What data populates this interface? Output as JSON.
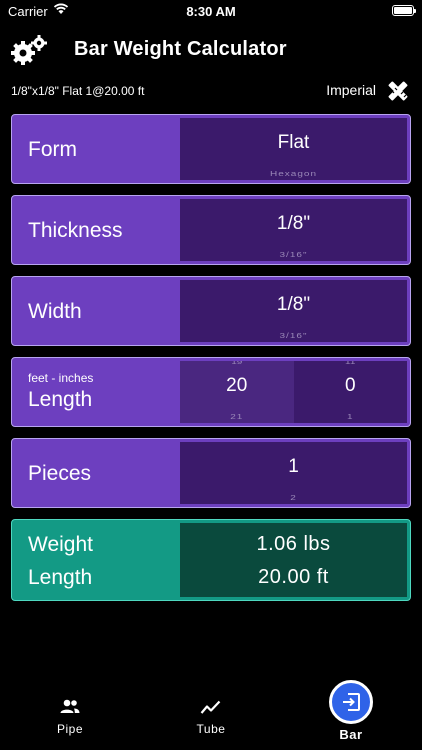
{
  "status": {
    "carrier": "Carrier",
    "time": "8:30 AM"
  },
  "header": {
    "title": "Bar Weight Calculator",
    "settings_icon": "gear-icon"
  },
  "subheader": {
    "summary": "1/8\"x1/8\" Flat 1@20.00 ft",
    "units": "Imperial",
    "units_icon": "ruler-pencil-icon"
  },
  "rows": {
    "form": {
      "label": "Form",
      "value": "Flat",
      "next": "Hexagon"
    },
    "thickness": {
      "label": "Thickness",
      "value": "1/8\"",
      "next": "3/16\""
    },
    "width": {
      "label": "Width",
      "value": "1/8\"",
      "next": "3/16\""
    },
    "length": {
      "sublabel": "feet - inches",
      "label": "Length",
      "feet": {
        "prev": "19",
        "value": "20",
        "next": "21"
      },
      "inches": {
        "prev": "11",
        "value": "0",
        "next": "1"
      }
    },
    "pieces": {
      "label": "Pieces",
      "value": "1",
      "next": "2"
    }
  },
  "result": {
    "weight_label": "Weight",
    "weight_value": "1.06  lbs",
    "length_label": "Length",
    "length_value": "20.00  ft"
  },
  "tabs": [
    {
      "label": "Pipe",
      "icon": "people-icon"
    },
    {
      "label": "Tube",
      "icon": "trend-line-icon"
    },
    {
      "label": "Bar",
      "icon": "exit-icon"
    }
  ],
  "colors": {
    "purple": "#6d3fbf",
    "picker": "#3b1a6b",
    "teal": "#139a85",
    "active_tab": "#2f63e8"
  }
}
